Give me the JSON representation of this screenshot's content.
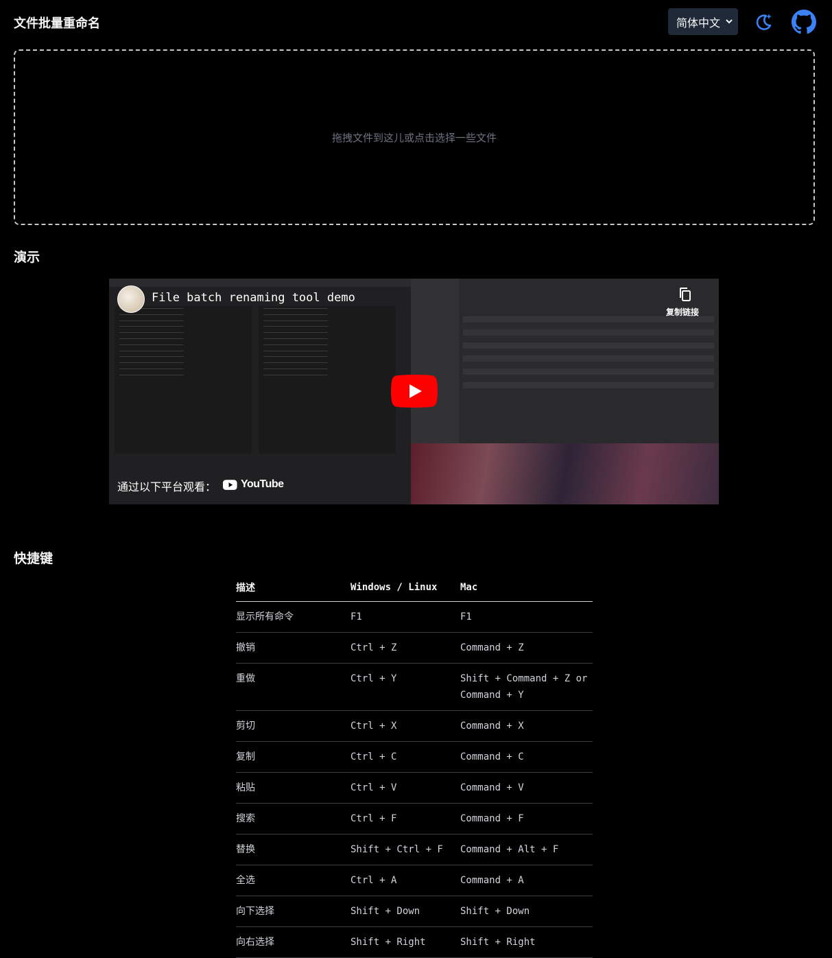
{
  "header": {
    "title": "文件批量重命名",
    "language_selected": "简体中文",
    "theme_icon": "moon-star-icon",
    "github_icon": "github-icon"
  },
  "dropzone": {
    "text": "拖拽文件到这儿或点击选择一些文件"
  },
  "demo": {
    "section_title": "演示",
    "video_title": "File batch renaming tool demo",
    "copy_link": "复制链接",
    "watch_on": "通过以下平台观看：",
    "platform": "YouTube"
  },
  "shortcuts": {
    "section_title": "快捷键",
    "columns": [
      "描述",
      "Windows / Linux",
      "Mac"
    ],
    "rows": [
      [
        "显示所有命令",
        "F1",
        "F1"
      ],
      [
        "撤销",
        "Ctrl + Z",
        "Command + Z"
      ],
      [
        "重做",
        "Ctrl + Y",
        "Shift + Command + Z or Command + Y"
      ],
      [
        "剪切",
        "Ctrl + X",
        "Command + X"
      ],
      [
        "复制",
        "Ctrl + C",
        "Command + C"
      ],
      [
        "粘贴",
        "Ctrl + V",
        "Command + V"
      ],
      [
        "搜索",
        "Ctrl + F",
        "Command + F"
      ],
      [
        "替换",
        "Shift + Ctrl + F",
        "Command + Alt + F"
      ],
      [
        "全选",
        "Ctrl + A",
        "Command + A"
      ],
      [
        "向下选择",
        "Shift + Down",
        "Shift + Down"
      ],
      [
        "向右选择",
        "Shift + Right",
        "Shift + Right"
      ]
    ]
  },
  "colors": {
    "background": "#000000",
    "accent_blue": "#3b82f6",
    "youtube_red": "#ff0000"
  }
}
